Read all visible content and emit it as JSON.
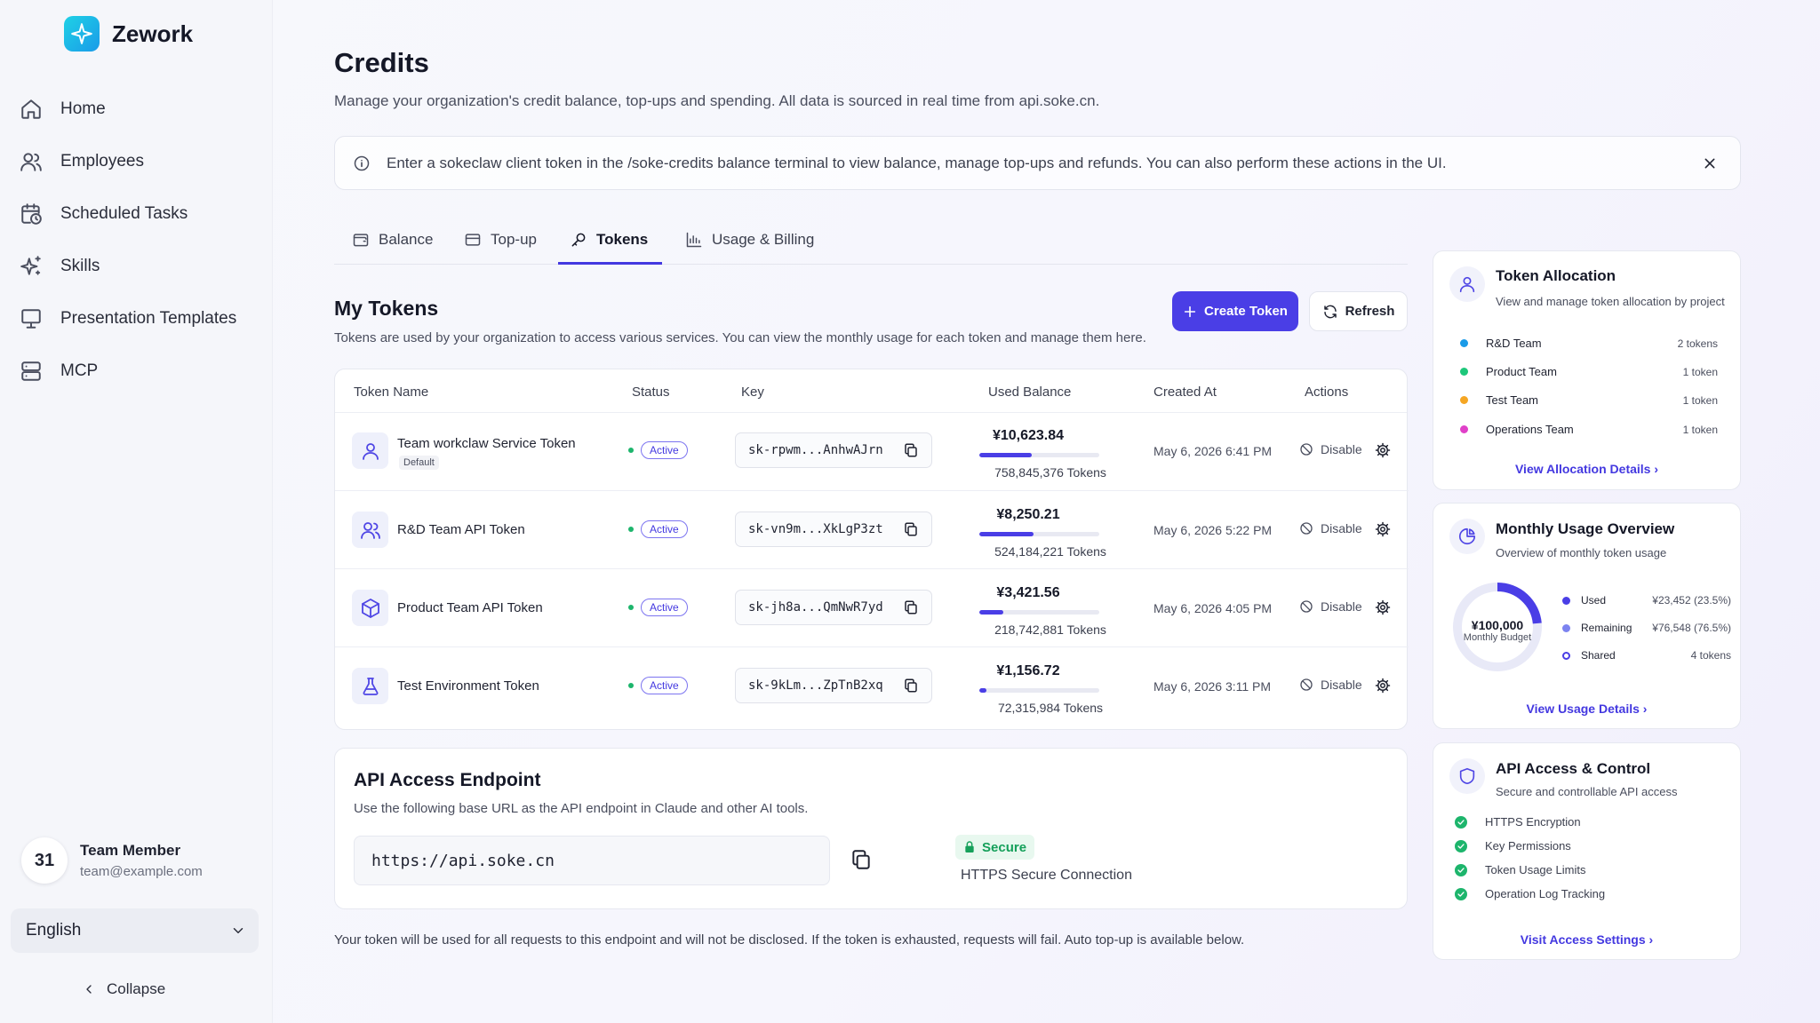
{
  "app": {
    "name": "Zework"
  },
  "sidebar": {
    "items": [
      {
        "label": "Home",
        "icon": "home-icon"
      },
      {
        "label": "Employees",
        "icon": "users-icon"
      },
      {
        "label": "Scheduled Tasks",
        "icon": "calendar-clock-icon"
      },
      {
        "label": "Skills",
        "icon": "sparkles-icon"
      },
      {
        "label": "Presentation Templates",
        "icon": "presentation-icon"
      },
      {
        "label": "MCP",
        "icon": "server-icon"
      }
    ],
    "user": {
      "avatar_text": "31",
      "name": "Team Member",
      "email": "team@example.com"
    },
    "language": "English",
    "collapse_label": "Collapse"
  },
  "page": {
    "title": "Credits",
    "subtitle": "Manage your organization's credit balance, top-ups and spending. All data is sourced in real time from api.soke.cn."
  },
  "notice": {
    "text": "Enter a sokeclaw client token in the /soke-credits balance terminal to view balance, manage top-ups and refunds. You can also perform these actions in the UI."
  },
  "tabs": [
    {
      "label": "Balance",
      "icon": "wallet-icon",
      "active": false
    },
    {
      "label": "Top-up",
      "icon": "card-icon",
      "active": false
    },
    {
      "label": "Tokens",
      "icon": "key-icon",
      "active": true
    },
    {
      "label": "Usage & Billing",
      "icon": "bar-chart-icon",
      "active": false
    }
  ],
  "tokens_section": {
    "title": "My Tokens",
    "subtitle": "Tokens are used by your organization to access various services. You can view the monthly usage for each token and manage them here.",
    "create_label": "Create Token",
    "refresh_label": "Refresh",
    "columns": [
      "Token Name",
      "Status",
      "Key",
      "Used Balance",
      "Created At",
      "Actions"
    ],
    "rows": [
      {
        "name": "Team workclaw Service Token",
        "tag": "Default",
        "status": "Active",
        "key": "sk-rpwm...AnhwAJrn",
        "used": "¥10,623.84",
        "used_fraction": 0.44,
        "tokens": "758,845,376 Tokens",
        "created": "May 6, 2026 6:41 PM",
        "action": "Disable",
        "icon": "user-icon"
      },
      {
        "name": "R&D Team API Token",
        "tag": "",
        "status": "Active",
        "key": "sk-vn9m...XkLgP3zt",
        "used": "¥8,250.21",
        "used_fraction": 0.45,
        "tokens": "524,184,221 Tokens",
        "created": "May 6, 2026 5:22 PM",
        "action": "Disable",
        "icon": "users-icon"
      },
      {
        "name": "Product Team API Token",
        "tag": "",
        "status": "Active",
        "key": "sk-jh8a...QmNwR7yd",
        "used": "¥3,421.56",
        "used_fraction": 0.2,
        "tokens": "218,742,881 Tokens",
        "created": "May 6, 2026 4:05 PM",
        "action": "Disable",
        "icon": "cube-icon"
      },
      {
        "name": "Test Environment Token",
        "tag": "",
        "status": "Active",
        "key": "sk-9kLm...ZpTnB2xq",
        "used": "¥1,156.72",
        "used_fraction": 0.06,
        "tokens": "72,315,984 Tokens",
        "created": "May 6, 2026 3:11 PM",
        "action": "Disable",
        "icon": "flask-icon"
      }
    ]
  },
  "endpoint": {
    "title": "API Access Endpoint",
    "subtitle": "Use the following base URL as the API endpoint in Claude and other AI tools.",
    "url": "https://api.soke.cn",
    "secure_label": "Secure",
    "secure_sub": "HTTPS Secure Connection",
    "footnote": "Your token will be used for all requests to this endpoint and will not be disclosed. If the token is exhausted, requests will fail. Auto top-up is available below."
  },
  "allocation": {
    "title": "Token Allocation",
    "subtitle": "View and manage token allocation by project",
    "teams": [
      {
        "name": "R&D Team",
        "count": "2 tokens",
        "color": "#1a9be8"
      },
      {
        "name": "Product Team",
        "count": "1 token",
        "color": "#1dc77a"
      },
      {
        "name": "Test Team",
        "count": "1 token",
        "color": "#f5a623"
      },
      {
        "name": "Operations Team",
        "count": "1 token",
        "color": "#e040c8"
      }
    ],
    "link": "View Allocation Details"
  },
  "usage": {
    "title": "Monthly Usage Overview",
    "subtitle": "Overview of monthly token usage",
    "budget": "¥100,000",
    "budget_label": "Monthly Budget",
    "used_fraction": 0.235,
    "legend": [
      {
        "label": "Used",
        "value": "¥23,452 (23.5%)",
        "color": "#4a3ee6"
      },
      {
        "label": "Remaining",
        "value": "¥76,548 (76.5%)",
        "color": "#7c83f0"
      },
      {
        "label": "Shared",
        "value": "4 tokens",
        "color": "#4a3ee6"
      }
    ],
    "link": "View Usage Details"
  },
  "access": {
    "title": "API Access & Control",
    "subtitle": "Secure and controllable API access",
    "features": [
      "HTTPS Encryption",
      "Key Permissions",
      "Token Usage Limits",
      "Operation Log Tracking"
    ],
    "link": "Visit Access Settings"
  }
}
